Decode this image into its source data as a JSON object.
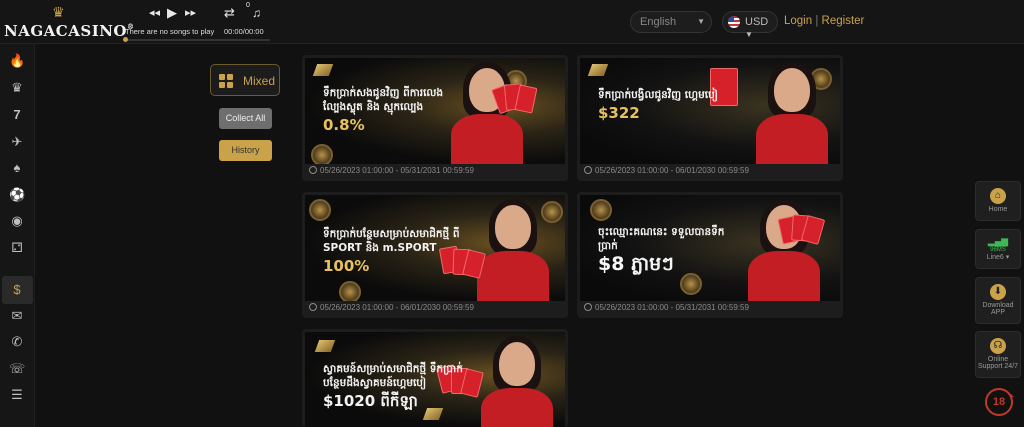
{
  "brand": {
    "name": "NAGACASINO",
    "reg": "®"
  },
  "player": {
    "prev_icon": "rewind-icon",
    "play_icon": "play-icon",
    "next_icon": "fast-forward-icon",
    "repeat_icon": "repeat-icon",
    "playlist_icon": "playlist-icon",
    "playlist_count": "0",
    "song": "There are no songs to play",
    "time": "00:00/00:00"
  },
  "header": {
    "language": "English",
    "currency": "USD",
    "login": "Login",
    "separator": "|",
    "register": "Register"
  },
  "sidebar": {
    "items": [
      {
        "icon": "fire-icon",
        "glyph": "🔥"
      },
      {
        "icon": "dealer-icon",
        "glyph": "♟"
      },
      {
        "icon": "slots-icon",
        "glyph": "7"
      },
      {
        "icon": "fishing-icon",
        "glyph": "✈"
      },
      {
        "icon": "cards-icon",
        "glyph": "🂡"
      },
      {
        "icon": "soccer-icon",
        "glyph": "⚽"
      },
      {
        "icon": "esports-icon",
        "glyph": "◉"
      },
      {
        "icon": "lottery-icon",
        "glyph": "⚁"
      },
      {
        "icon": "promotions-icon",
        "glyph": "$"
      },
      {
        "icon": "gift-icon",
        "glyph": "🎁"
      },
      {
        "icon": "megaphone-icon",
        "glyph": "📢"
      },
      {
        "icon": "support-icon",
        "glyph": "☏"
      },
      {
        "icon": "report-icon",
        "glyph": "📋"
      }
    ]
  },
  "filter": {
    "label": "Mixed",
    "icon": "grid-icon"
  },
  "buttons": {
    "collect_all": "Collect All",
    "history": "History"
  },
  "promotions": [
    {
      "text": "ទឹកប្រាក់សងជូនវិញ ពីការលេងល្បែងស្លុត និង ស្មុកល្បេង",
      "amount": "0.8%",
      "period": "05/26/2023 01:00:00 - 05/31/2031 00:59:59"
    },
    {
      "text": "ទឹកប្រាក់បង្វិលជូនវិញ ហ្គេមបៀ",
      "amount": "$322",
      "period": "05/26/2023 01:00:00 - 06/01/2030 00:59:59"
    },
    {
      "text": "ទឹកប្រាក់បន្ថែមសម្រាប់សមាជិកថ្មី ពី SPORT និង m.SPORT",
      "amount": "100%",
      "period": "05/26/2023 01:00:00 - 06/01/2030 00:59:59"
    },
    {
      "text": "ចុះឈ្មោះគណនេះ ទទួលបានទឹកប្រាក់",
      "amount": "$8 ភ្លាមៗ",
      "period": "05/26/2023 01:00:00 - 05/31/2031 00:59:59"
    },
    {
      "text": "ស្វាគមន៍សម្រាប់សមាជិកថ្មី ទឹកប្រាក់បន្ថែមដឹងស្វាគមន៍ហ្គេមបៀ",
      "amount": "$1020 ពីកីឡា",
      "period": ""
    }
  ],
  "rightbar": {
    "home": "Home",
    "line": "Line6",
    "line_ms": "96MS",
    "download": "Download APP",
    "support": "Online Support 24/7"
  },
  "age_badge": {
    "label": "18",
    "plus": "+"
  },
  "colors": {
    "accent": "#c9a24a",
    "background": "#111111",
    "card": "#1d1d1d"
  }
}
